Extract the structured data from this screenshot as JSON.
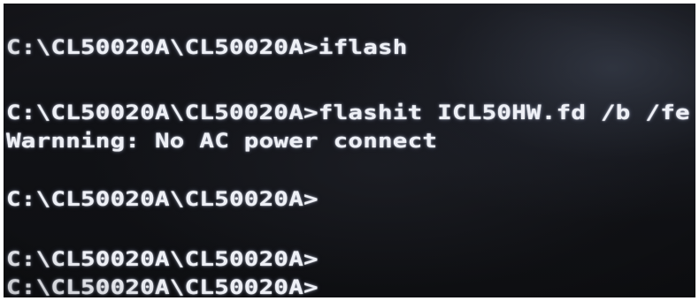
{
  "console": {
    "lines": [
      "C:\\CL50020A\\CL50020A>iflash",
      "C:\\CL50020A\\CL50020A>flashit ICL50HW.fd /b /fe",
      "Warnning: No AC power connect",
      "C:\\CL50020A\\CL50020A>",
      "C:\\CL50020A\\CL50020A>",
      "C:\\CL50020A\\CL50020A>"
    ]
  },
  "colors": {
    "background": "#111216",
    "text": "#eef0f6"
  }
}
